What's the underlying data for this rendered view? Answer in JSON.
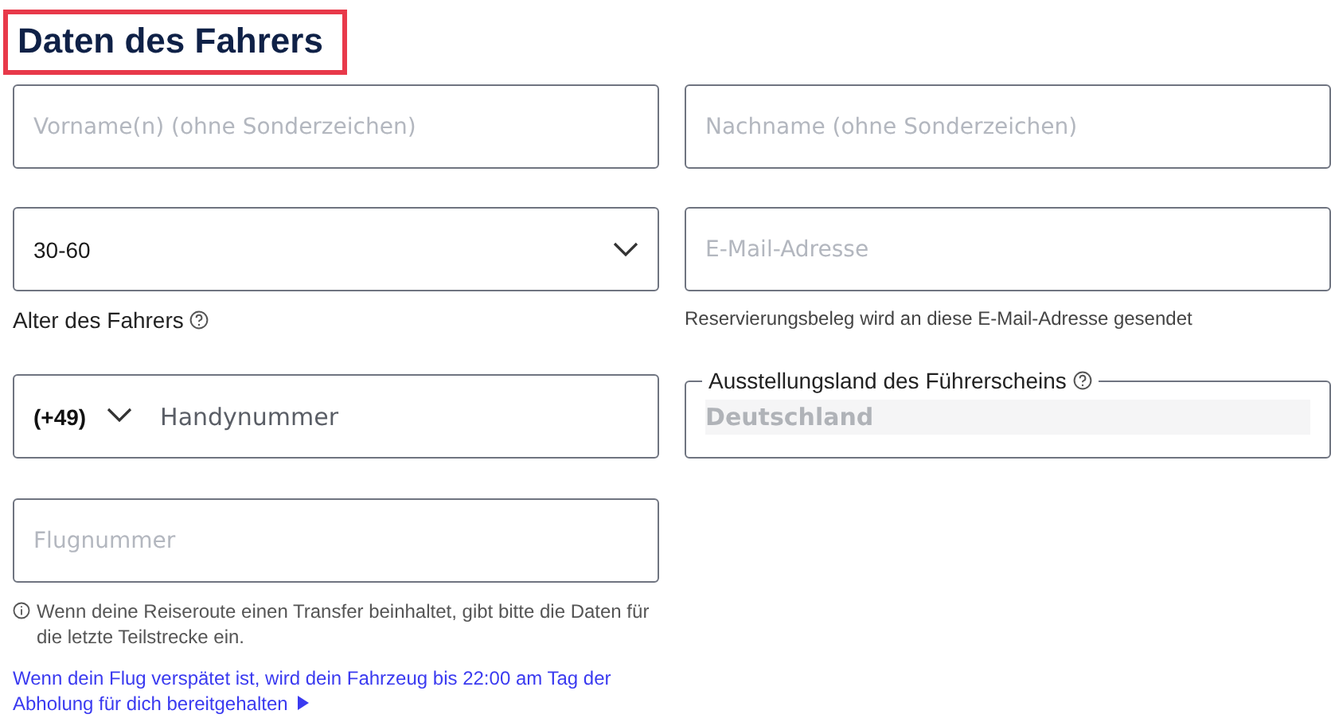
{
  "title": {
    "text": "Daten des Fahrers",
    "highlighted": true
  },
  "fields": [
    {
      "kind": "text",
      "placeholder": "Vorname(n) (ohne Sonderzeichen)"
    },
    {
      "kind": "text",
      "placeholder": "Nachname (ohne Sonderzeichen)"
    },
    {
      "kind": "select",
      "value": "30-60",
      "hint": "Alter des Fahrers"
    },
    {
      "kind": "text",
      "placeholder": "E-Mail-Adresse",
      "hint": "Reservierungsbeleg wird an diese E-Mail-Adresse gesendet"
    },
    {
      "kind": "phone",
      "prefix": "(+49)",
      "placeholder": "Handynummer"
    },
    {
      "kind": "legend",
      "label": "Ausstellungsland des Führerscheins",
      "value": "Deutschland",
      "disabled": true
    },
    {
      "kind": "text",
      "placeholder": "Flugnummer",
      "info": "Wenn deine Reiseroute einen Transfer beinhaltet, gibt bitte die Daten für die letzte Teilstrecke ein.",
      "link": "Wenn dein Flug verspätet ist, wird dein Fahrzeug bis 22:00 am Tag der Abholung für dich bereitgehalten"
    }
  ]
}
